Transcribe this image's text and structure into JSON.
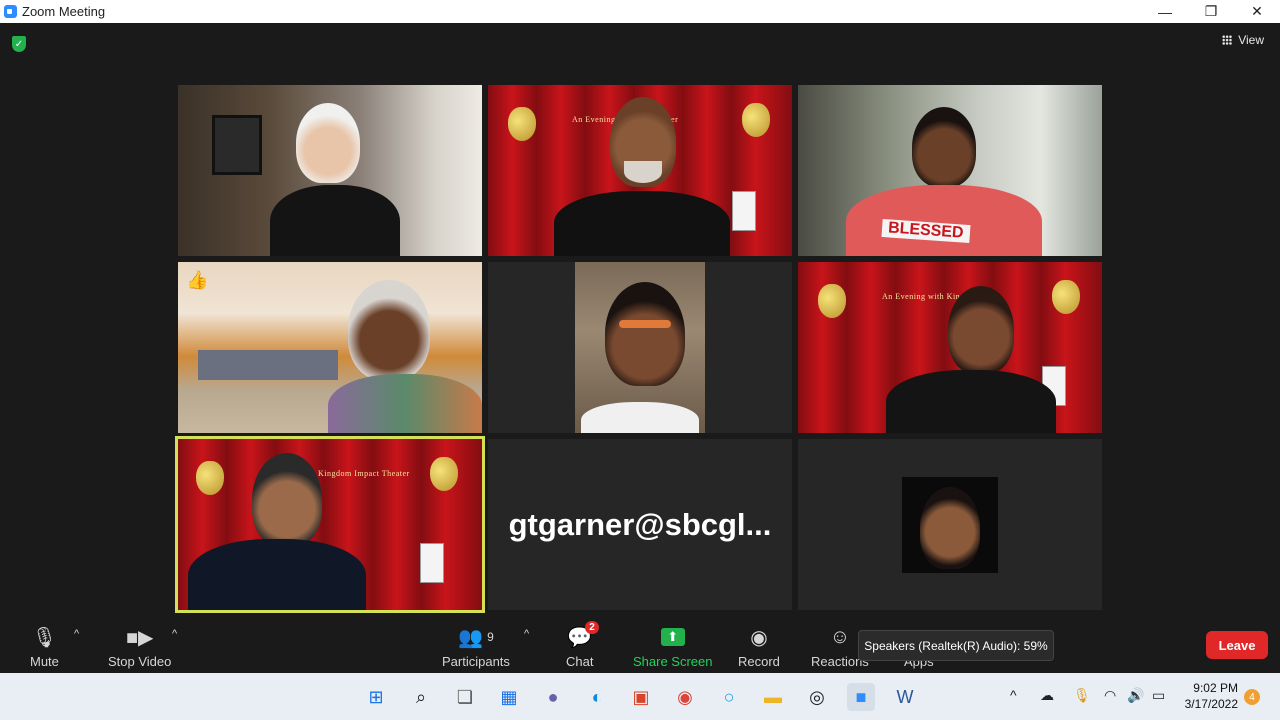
{
  "window": {
    "title": "Zoom Meeting",
    "minimize": "—",
    "restore": "❐",
    "close": "✕"
  },
  "header": {
    "view_label": "View",
    "shield_glyph": "✓"
  },
  "tiles": [
    {
      "id": "p1",
      "kind": "video",
      "background": "room"
    },
    {
      "id": "p2",
      "kind": "video",
      "background": "curtain",
      "stage_title": "An Evening w... ...ct Theater"
    },
    {
      "id": "p3",
      "kind": "video",
      "background": "room",
      "shirt_text": "BLESSED"
    },
    {
      "id": "p4",
      "kind": "video",
      "background": "room",
      "reaction": "👍"
    },
    {
      "id": "p5",
      "kind": "video",
      "background": "room"
    },
    {
      "id": "p6",
      "kind": "video",
      "background": "curtain",
      "stage_title": "An Evening with Kingd... ...ater"
    },
    {
      "id": "p7",
      "kind": "video",
      "background": "curtain",
      "stage_title": "Kingdom Impact Theater",
      "active_speaker": true
    },
    {
      "id": "p8",
      "kind": "name",
      "name": "gtgarner@sbcgl..."
    },
    {
      "id": "p9",
      "kind": "avatar"
    }
  ],
  "toolbar": {
    "mute_label": "Mute",
    "stop_video_label": "Stop Video",
    "participants_label": "Participants",
    "participants_count": "9",
    "chat_label": "Chat",
    "chat_badge": "2",
    "share_screen_label": "Share Screen",
    "record_label": "Record",
    "reactions_label": "Reactions",
    "apps_label": "Apps",
    "leave_label": "Leave",
    "caret": "^"
  },
  "tooltip": {
    "text": "Speakers (Realtek(R) Audio): 59%"
  },
  "taskbar": {
    "time": "9:02 PM",
    "date": "3/17/2022",
    "notification_count": "4",
    "apps": [
      "windows-start",
      "search",
      "task-view",
      "widgets",
      "teams-chat",
      "edge",
      "store",
      "chrome",
      "cortana",
      "file-explorer",
      "dell",
      "zoom",
      "word"
    ]
  },
  "colors": {
    "active_outline": "#d4e157",
    "leave": "#e02828",
    "share": "#23b14d",
    "curtain": "#c8141a"
  }
}
